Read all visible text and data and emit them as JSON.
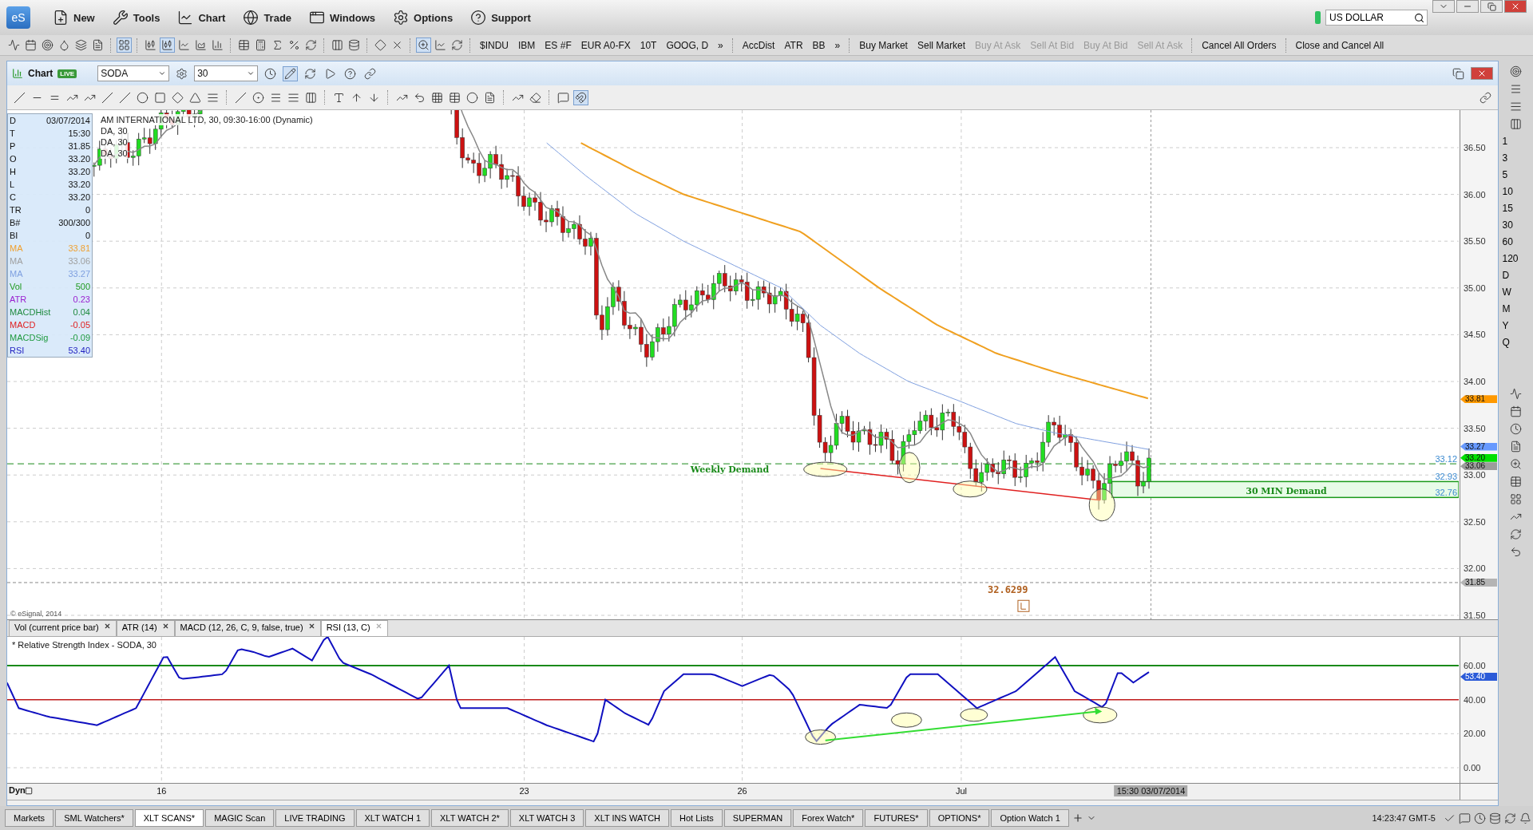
{
  "logo": "eS",
  "app_menu": [
    {
      "label": "New",
      "kind": "new"
    },
    {
      "label": "Tools",
      "kind": "tools"
    },
    {
      "label": "Chart",
      "kind": "chart"
    },
    {
      "label": "Trade",
      "kind": "trade"
    },
    {
      "label": "Windows",
      "kind": "windows"
    },
    {
      "label": "Options",
      "kind": "options"
    },
    {
      "label": "Support",
      "kind": "support"
    }
  ],
  "search": {
    "value": "US DOLLAR"
  },
  "toolbar": {
    "symbols": [
      "$INDU",
      "IBM",
      "ES #F",
      "EUR A0-FX",
      "10T",
      "GOOG, D"
    ],
    "more_symbols": "»",
    "studies": [
      "AccDist",
      "ATR",
      "BB"
    ],
    "more_studies": "»",
    "orders": [
      {
        "label": "Buy Market",
        "disabled": false
      },
      {
        "label": "Sell Market",
        "disabled": false
      },
      {
        "label": "Buy At Ask",
        "disabled": true
      },
      {
        "label": "Sell At Bid",
        "disabled": true
      },
      {
        "label": "Buy At Bid",
        "disabled": true
      },
      {
        "label": "Sell At Ask",
        "disabled": true
      },
      {
        "label": "Cancel All Orders",
        "disabled": false
      },
      {
        "label": "Close and Cancel All",
        "disabled": false
      }
    ]
  },
  "chart_window": {
    "title": "Chart",
    "badge": "LIVE",
    "symbol": "SODA",
    "interval": "30",
    "legend": [
      "AM INTERNATIONAL LTD, 30, 09:30-16:00 (Dynamic)",
      "DA, 30",
      "DA, 30",
      "DA, 30"
    ],
    "data_window": [
      {
        "label": "D",
        "value": "03/07/2014"
      },
      {
        "label": "T",
        "value": "15:30"
      },
      {
        "label": "P",
        "value": "31.85"
      },
      {
        "label": "O",
        "value": "33.20"
      },
      {
        "label": "H",
        "value": "33.20"
      },
      {
        "label": "L",
        "value": "33.20"
      },
      {
        "label": "C",
        "value": "33.20"
      },
      {
        "label": "TR",
        "value": "0"
      },
      {
        "label": "B#",
        "value": "300/300"
      },
      {
        "label": "BI",
        "value": "0"
      },
      {
        "label": "MA",
        "value": "33.81",
        "color": "#f0a030"
      },
      {
        "label": "MA",
        "value": "33.06",
        "color": "#a0a0a0"
      },
      {
        "label": "MA",
        "value": "33.27",
        "color": "#7fa0e0"
      },
      {
        "label": "Vol",
        "value": "500",
        "color": "#1f9a1f"
      },
      {
        "label": "ATR",
        "value": "0.23",
        "color": "#9a1fd0"
      },
      {
        "label": "MACDHist",
        "value": "0.04",
        "color": "#1f8a3f"
      },
      {
        "label": "MACD",
        "value": "-0.05",
        "color": "#e01f1f"
      },
      {
        "label": "MACDSig",
        "value": "-0.09",
        "color": "#1f9a3f"
      },
      {
        "label": "RSI",
        "value": "53.40",
        "color": "#1f1fc0"
      }
    ],
    "price_axis": [
      "36.50",
      "36.00",
      "35.50",
      "35.00",
      "34.50",
      "34.00",
      "33.50",
      "33.00",
      "32.50",
      "32.00",
      "31.50"
    ],
    "price_flags": [
      {
        "value": "33.81",
        "color": "#ff9900"
      },
      {
        "value": "33.27",
        "color": "#6699ff"
      },
      {
        "value": "33.20",
        "color": "#00e000"
      },
      {
        "value": "33.06",
        "color": "#9c9c9c"
      },
      {
        "value": "31.85",
        "color": "#b4b4b4"
      }
    ],
    "level_labels": [
      "33.12",
      "32.93",
      "32.76"
    ],
    "weekly_demand": "Weekly Demand",
    "min_demand": "30 MIN Demand",
    "price_note": "32.6299",
    "copyright": "© eSignal, 2014",
    "study_tabs": [
      {
        "label": "Vol (current price bar)",
        "selected": false
      },
      {
        "label": "ATR (14)",
        "selected": false
      },
      {
        "label": "MACD (12, 26, C, 9, false, true)",
        "selected": false
      },
      {
        "label": "RSI (13, C)",
        "selected": true
      }
    ],
    "rsi_title": "* Relative Strength Index - SODA, 30",
    "rsi_axis": [
      "60.00",
      "40.00",
      "20.00",
      "0.00"
    ],
    "rsi_flag": "53.40",
    "dyn": "Dyn",
    "date_axis": [
      "16",
      "23",
      "26",
      "Jul"
    ],
    "cursor_label": "15:30 03/07/2014"
  },
  "intervals": [
    "1",
    "3",
    "5",
    "10",
    "15",
    "30",
    "60",
    "120",
    "D",
    "W",
    "M",
    "Y",
    "Q"
  ],
  "page_tabs": [
    {
      "label": "Markets",
      "selected": false
    },
    {
      "label": "SML Watchers*",
      "selected": false
    },
    {
      "label": "XLT SCANS*",
      "selected": true
    },
    {
      "label": "MAGIC Scan",
      "selected": false
    },
    {
      "label": "LIVE TRADING",
      "selected": false
    },
    {
      "label": "XLT WATCH 1",
      "selected": false
    },
    {
      "label": "XLT WATCH 2*",
      "selected": false
    },
    {
      "label": "XLT WATCH 3",
      "selected": false
    },
    {
      "label": "XLT INS WATCH",
      "selected": false
    },
    {
      "label": "Hot Lists",
      "selected": false
    },
    {
      "label": "SUPERMAN",
      "selected": false
    },
    {
      "label": "Forex Watch*",
      "selected": false
    },
    {
      "label": "FUTURES*",
      "selected": false
    },
    {
      "label": "OPTIONS*",
      "selected": false
    },
    {
      "label": "Option Watch 1",
      "selected": false
    }
  ],
  "clock": "14:23:47 GMT-5"
}
